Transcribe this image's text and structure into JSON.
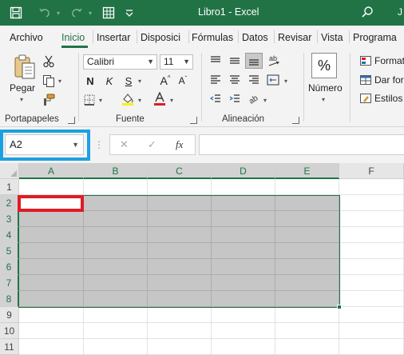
{
  "app": {
    "document_title": "Libro1  -  Excel",
    "user_initial": "J"
  },
  "quick_access": [
    {
      "icon": "save-icon",
      "glyph": "💾"
    },
    {
      "icon": "undo-icon",
      "glyph": "↶"
    },
    {
      "icon": "redo-icon",
      "glyph": "↷"
    },
    {
      "icon": "borders-icon",
      "glyph": "⊞"
    },
    {
      "icon": "customize-icon",
      "glyph": "⩡"
    }
  ],
  "tabs": [
    "Archivo",
    "Inicio",
    "Insertar",
    "Disposici",
    "Fórmulas",
    "Datos",
    "Revisar",
    "Vista",
    "Programa"
  ],
  "ribbon": {
    "clipboard": {
      "label": "Portapapeles",
      "paste_label": "Pegar"
    },
    "font": {
      "label": "Fuente",
      "font_name": "Calibri",
      "font_size": "11",
      "bold": "N",
      "italic": "K",
      "underline": "S",
      "grow": "A",
      "shrink": "A"
    },
    "alignment": {
      "label": "Alineación"
    },
    "number": {
      "label": "Número",
      "symbol": "%"
    },
    "styles": {
      "items": [
        "Format",
        "Dar for",
        "Estilos d"
      ]
    }
  },
  "formula_bar": {
    "name_box": "A2",
    "cancel": "✕",
    "enter": "✓",
    "fx": "fx",
    "value": ""
  },
  "sheet": {
    "columns": [
      "A",
      "B",
      "C",
      "D",
      "E",
      "F"
    ],
    "rows": [
      "1",
      "2",
      "3",
      "4",
      "5",
      "6",
      "7",
      "8",
      "9",
      "10",
      "11"
    ],
    "selection": "A2:E8",
    "active_cell": "A2"
  },
  "colors": {
    "excel_green": "#217346",
    "namebox_highlight": "#1ba1e2",
    "active_cell_highlight": "#e01b24",
    "selection_fill": "#c6c6c6"
  }
}
